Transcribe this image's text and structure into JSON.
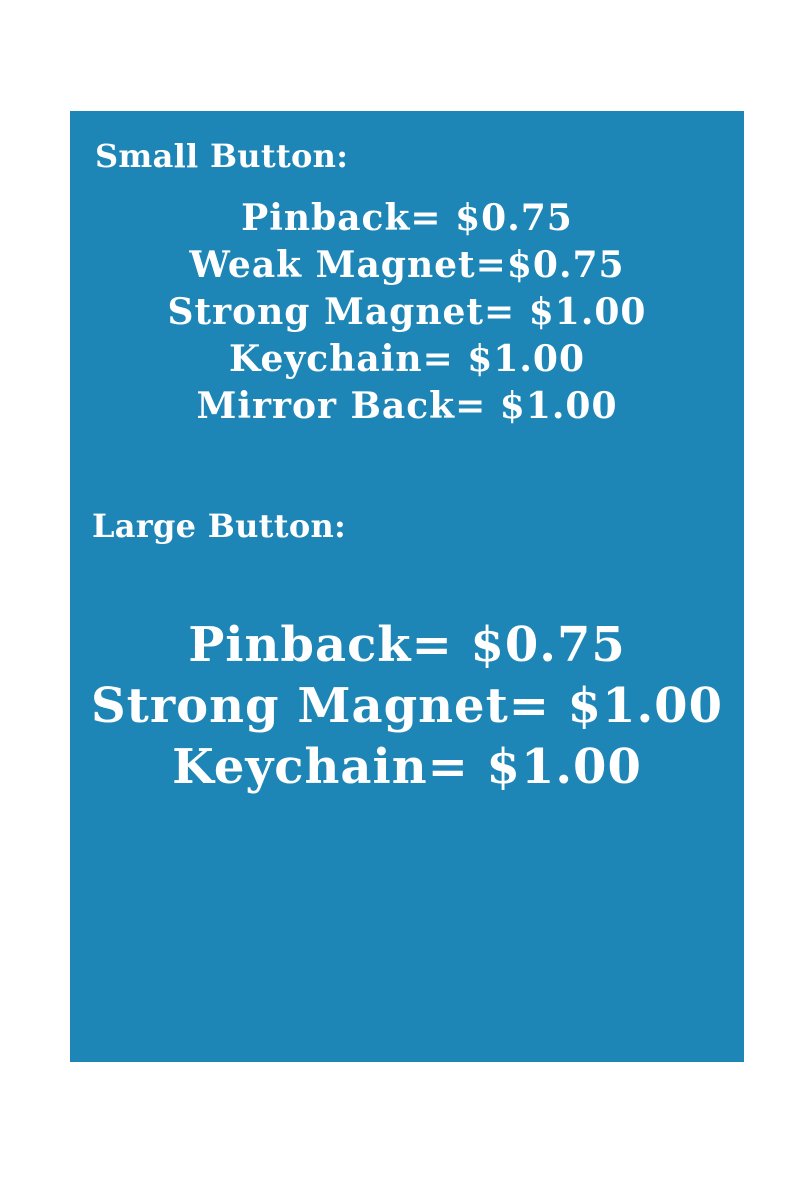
{
  "colors": {
    "panel_background": "#1e86b6",
    "text": "#ffffff",
    "page_background": "#ffffff"
  },
  "small_button": {
    "heading": "Small Button:",
    "items": [
      "Pinback= $0.75",
      "Weak Magnet=$0.75",
      "Strong Magnet= $1.00",
      "Keychain= $1.00",
      "Mirror Back= $1.00"
    ]
  },
  "large_button": {
    "heading": "Large Button:",
    "items": [
      "Pinback= $0.75",
      "Strong Magnet= $1.00",
      "Keychain= $1.00"
    ]
  }
}
